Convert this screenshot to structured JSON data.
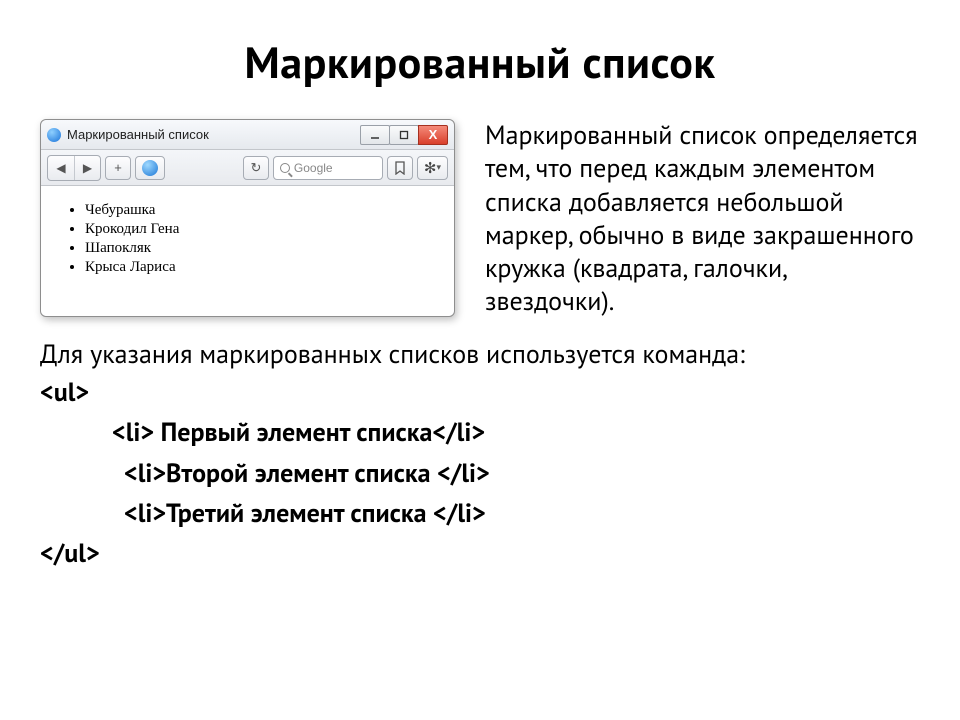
{
  "title": "Маркированный список",
  "browser": {
    "window_title": "Маркированный список",
    "search_placeholder": "Google",
    "list_items": [
      "Чебурашка",
      "Крокодил Гена",
      "Шапокляк",
      "Крыса Лариса"
    ]
  },
  "paragraph1": "Маркированный список определяется тем, что перед каждым элементом списка добавляется небольшой маркер, обычно в виде закрашенного кружка (квадрата, галочки, звездочки).",
  "paragraph2": "Для указания маркированных списков используется команда:",
  "code": {
    "open": "<ul>",
    "li1": "<li> Первый элемент списка</li>",
    "li2": "<li>Второй элемент списка </li>",
    "li3": "<li>Третий элемент списка </li>",
    "close": "</ul>"
  }
}
